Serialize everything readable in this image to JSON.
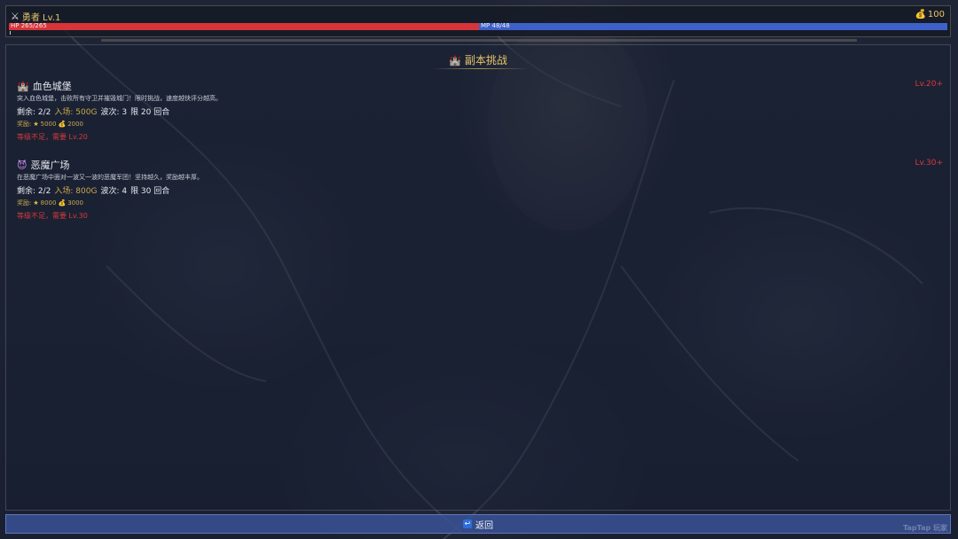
{
  "player": {
    "name_level": "勇者 Lv.1",
    "gold": "100",
    "hp_text": "HP 265/265",
    "mp_text": "MP 48/48"
  },
  "panel": {
    "title": "副本挑战"
  },
  "dungeons": [
    {
      "name": "血色城堡",
      "icon": "castle-icon",
      "level_req": "Lv.20+",
      "description": "突入血色城堡，击败所有守卫并摧毁城门！限时挑战，速度越快评分越高。",
      "remaining_label": "剩余: 2/2",
      "entry_cost": "入场: 500G",
      "waves": "波次: 3",
      "turn_limit": "限 20 回合",
      "rewards_label": "奖励:",
      "reward_exp": "5000",
      "reward_gold": "2000",
      "warning": "等级不足，需要 Lv.20"
    },
    {
      "name": "恶魔广场",
      "icon": "demon-icon",
      "level_req": "Lv.30+",
      "description": "在恶魔广场中面对一波又一波的恶魔军团！坚持越久，奖励越丰厚。",
      "remaining_label": "剩余: 2/2",
      "entry_cost": "入场: 800G",
      "waves": "波次: 4",
      "turn_limit": "限 30 回合",
      "rewards_label": "奖励:",
      "reward_exp": "8000",
      "reward_gold": "3000",
      "warning": "等级不足，需要 Lv.30"
    }
  ],
  "back_button": {
    "label": "返回"
  },
  "watermark": "TapTap 玩家"
}
